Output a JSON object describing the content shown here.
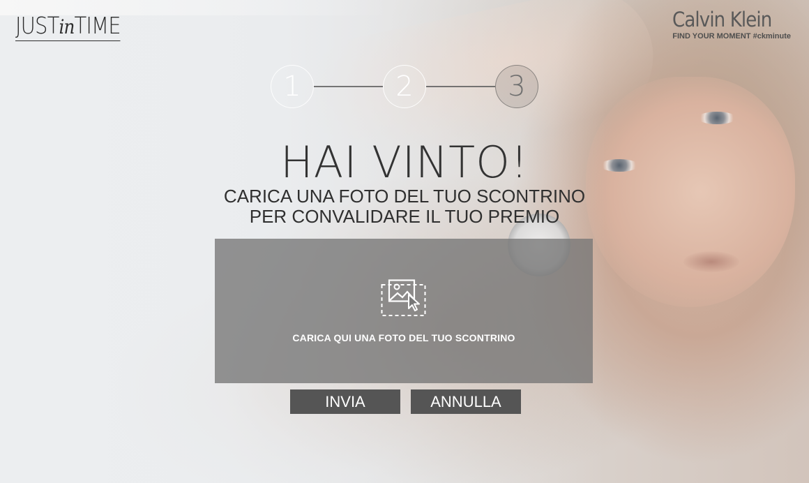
{
  "header": {
    "logo_left": {
      "part1": "JUST",
      "part2": "in",
      "part3": "TIME"
    },
    "logo_right": {
      "brand": "Calvin Klein",
      "tagline": "FIND YOUR MOMENT #ckminute"
    }
  },
  "stepper": {
    "steps": [
      {
        "label": "1",
        "state": "done"
      },
      {
        "label": "2",
        "state": "active"
      },
      {
        "label": "3",
        "state": "pending"
      }
    ],
    "current_step": 2
  },
  "main": {
    "title": "HAI VINTO!",
    "subtitle_line1": "CARICA UNA FOTO DEL TUO SCONTRINO",
    "subtitle_line2": "PER CONVALIDARE IL TUO PREMIO"
  },
  "upload": {
    "icon": "image-upload-icon",
    "label": "CARICA QUI UNA FOTO DEL TUO SCONTRINO"
  },
  "actions": {
    "send_label": "INVIA",
    "cancel_label": "ANNULLA"
  },
  "colors": {
    "button_bg": "#555555",
    "upload_bg": "#767676",
    "text_dark": "#333333"
  }
}
